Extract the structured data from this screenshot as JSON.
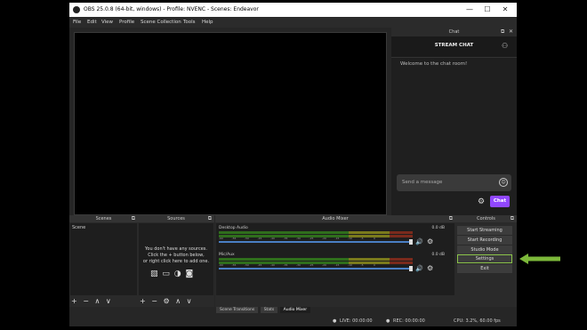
{
  "window": {
    "title": "OBS 25.0.8 (64-bit, windows) - Profile: NVENC - Scenes: Endeavor",
    "minimize": "—",
    "maximize": "☐",
    "close": "✕"
  },
  "menu": [
    "File",
    "Edit",
    "View",
    "Profile",
    "Scene Collection",
    "Tools",
    "Help"
  ],
  "chat": {
    "dock_title": "Chat",
    "header": "STREAM CHAT",
    "welcome": "Welcome to the chat room!",
    "input_placeholder": "Send a message",
    "send_label": "Chat"
  },
  "scenes": {
    "title": "Scenes",
    "items": [
      "Scene"
    ],
    "footer": [
      "+",
      "−",
      "∧",
      "∨"
    ]
  },
  "sources": {
    "title": "Sources",
    "empty_line1": "You don't have any sources.",
    "empty_line2": "Click the + button below,",
    "empty_line3": "or right click here to add one.",
    "footer": [
      "+",
      "−",
      "⚙",
      "∧",
      "∨"
    ]
  },
  "mixer": {
    "title": "Audio Mixer",
    "channels": [
      {
        "name": "Desktop Audio",
        "db": "0.0 dB",
        "volume": 1.0
      },
      {
        "name": "Mic/Aux",
        "db": "0.0 dB",
        "volume": 1.0
      }
    ],
    "ticks": [
      "-60",
      "-55",
      "-50",
      "-45",
      "-40",
      "-35",
      "-30",
      "-25",
      "-20",
      "-15",
      "-10",
      "-5",
      "0"
    ]
  },
  "bottom_tabs": [
    "Scene Transitions",
    "Stats",
    "Audio Mixer"
  ],
  "controls": {
    "title": "Controls",
    "start_streaming": "Start Streaming",
    "start_recording": "Start Recording",
    "studio_mode": "Studio Mode",
    "settings": "Settings",
    "exit": "Exit"
  },
  "status": {
    "live": "LIVE: 00:00:00",
    "rec": "REC: 00:00:00",
    "cpu": "CPU: 3.2%, 60.00 fps"
  },
  "colors": {
    "accent_chat": "#9147ff",
    "highlight": "#8bc34a",
    "arrow": "#7cb83a"
  }
}
